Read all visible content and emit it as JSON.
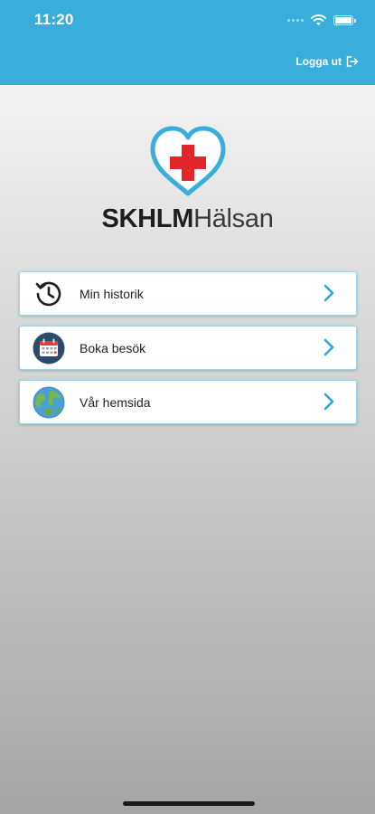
{
  "status_bar": {
    "time": "11:20"
  },
  "header": {
    "logout_label": "Logga ut"
  },
  "logo": {
    "name_bold": "SKHLM",
    "name_light": "Hälsan",
    "icon": "heart-cross-icon"
  },
  "menu": {
    "items": [
      {
        "label": "Min historik",
        "icon": "history-icon"
      },
      {
        "label": "Boka besök",
        "icon": "calendar-icon"
      },
      {
        "label": "Vår hemsida",
        "icon": "globe-icon"
      }
    ]
  },
  "colors": {
    "accent": "#3aaedb",
    "cross": "#e3262c",
    "chevron": "#2ea8dc"
  }
}
